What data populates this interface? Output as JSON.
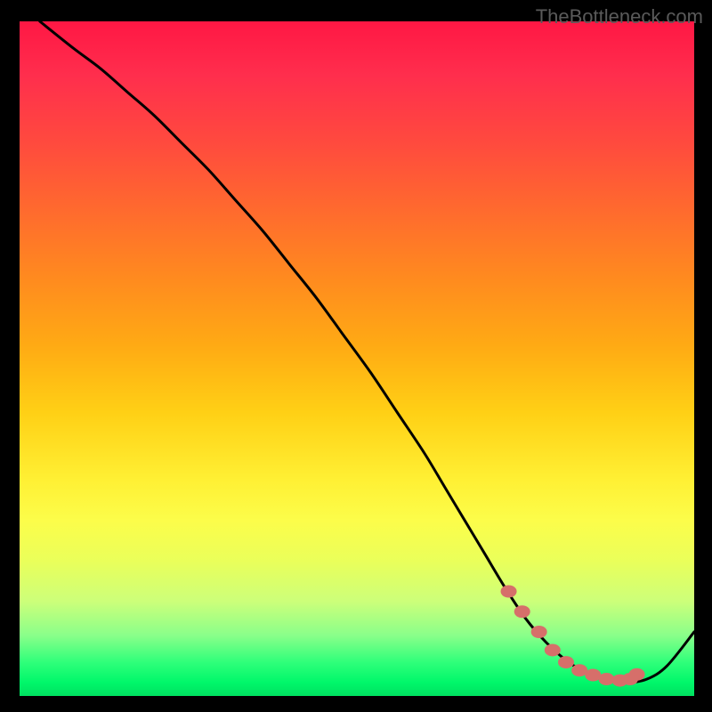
{
  "watermark": "TheBottleneck.com",
  "chart_data": {
    "type": "line",
    "title": "",
    "xlabel": "",
    "ylabel": "",
    "xlim": [
      0,
      100
    ],
    "ylim": [
      0,
      100
    ],
    "series": [
      {
        "name": "curve",
        "x": [
          3,
          8,
          12,
          16,
          20,
          24,
          28,
          32,
          36,
          40,
          44,
          48,
          52,
          56,
          60,
          63,
          66,
          69,
          72,
          75,
          78,
          81,
          84,
          87,
          90,
          93,
          96,
          100
        ],
        "y": [
          100,
          96,
          93,
          89.5,
          86,
          82,
          78,
          73.5,
          69,
          64,
          59,
          53.5,
          48,
          42,
          36,
          31,
          26,
          21,
          16,
          11.5,
          8,
          5.3,
          3.4,
          2.3,
          2,
          2.5,
          4.5,
          9.5
        ]
      }
    ],
    "markers": {
      "name": "range-dots",
      "x": [
        72.5,
        74.5,
        77,
        79,
        81,
        83,
        85,
        87,
        89,
        90.5,
        91.5
      ],
      "y": [
        15.5,
        12.5,
        9.5,
        6.8,
        5.0,
        3.8,
        3.1,
        2.5,
        2.3,
        2.5,
        3.2
      ]
    },
    "gradient_stops": [
      {
        "pos": 0,
        "color": "#ff1744"
      },
      {
        "pos": 50,
        "color": "#ffb400"
      },
      {
        "pos": 75,
        "color": "#fff040"
      },
      {
        "pos": 100,
        "color": "#00e060"
      }
    ]
  }
}
